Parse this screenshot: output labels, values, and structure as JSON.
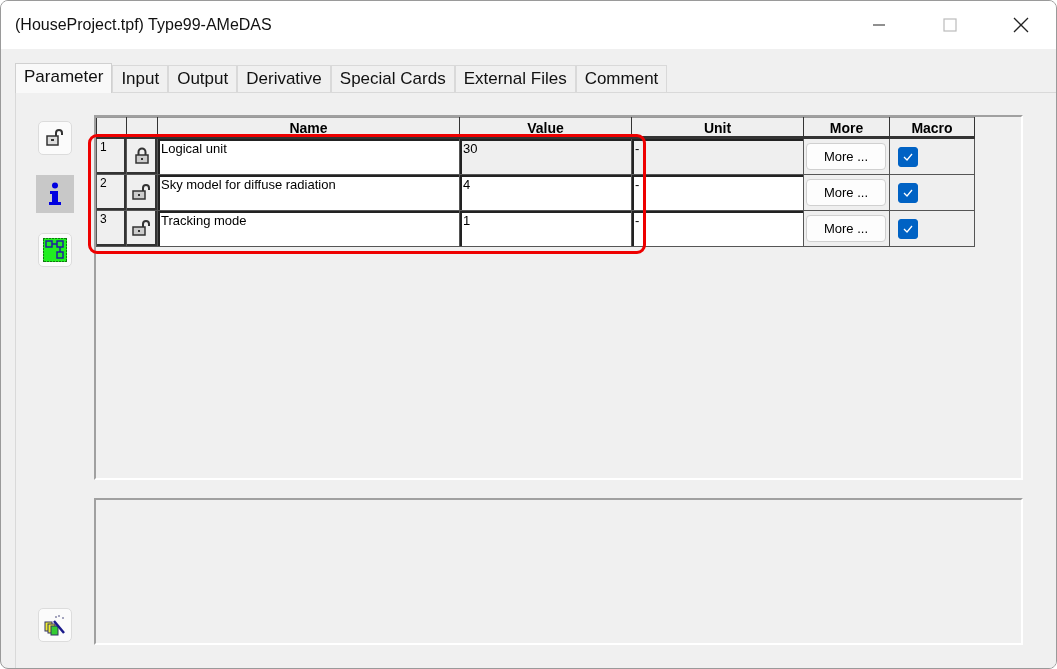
{
  "window": {
    "title": "(HouseProject.tpf) Type99-AMeDAS"
  },
  "tabs": [
    {
      "label": "Parameter",
      "selected": true
    },
    {
      "label": "Input",
      "selected": false
    },
    {
      "label": "Output",
      "selected": false
    },
    {
      "label": "Derivative",
      "selected": false
    },
    {
      "label": "Special Cards",
      "selected": false
    },
    {
      "label": "External Files",
      "selected": false
    },
    {
      "label": "Comment",
      "selected": false
    }
  ],
  "tools": [
    {
      "kind": "unlock",
      "selected": false
    },
    {
      "kind": "info",
      "selected": true
    },
    {
      "kind": "diagram",
      "selected": false
    }
  ],
  "table": {
    "columns": [
      "Name",
      "Value",
      "Unit",
      "More",
      "Macro"
    ],
    "rows": [
      {
        "index": "1",
        "locked": true,
        "name": "Logical unit",
        "value": "30",
        "unit": "-",
        "more": "More ...",
        "macro": true
      },
      {
        "index": "2",
        "locked": false,
        "name": "Sky model for diffuse radiation",
        "value": "4",
        "unit": "-",
        "more": "More ...",
        "macro": true
      },
      {
        "index": "3",
        "locked": false,
        "name": "Tracking mode",
        "value": "1",
        "unit": "-",
        "more": "More ...",
        "macro": true
      }
    ],
    "highlighted": true
  }
}
